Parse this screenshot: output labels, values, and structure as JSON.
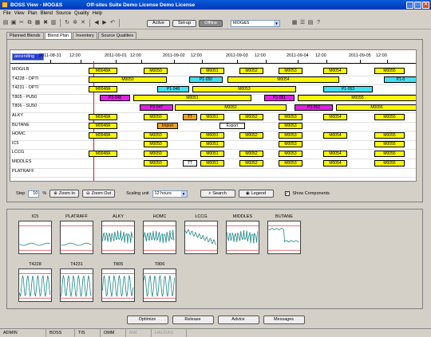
{
  "window": {
    "title": "BOSS View - MOG&S",
    "subtitle": "Off-sites Suite Demo License     Demo License"
  },
  "menu": [
    "File",
    "View",
    "Plan",
    "Blend",
    "Source",
    "Quality",
    "Help"
  ],
  "toolbar": {
    "modes": [
      "Active",
      "Set-up",
      "Offline"
    ],
    "selected_mode": "Offline",
    "site_combo": "MOG&S"
  },
  "tabs": [
    "Planned Blends",
    "Blend Plan",
    "Inventory",
    "Source Qualities"
  ],
  "selected_tab": "Blend Plan",
  "gantt": {
    "sort": "ascending",
    "dates": [
      "2011-08-31",
      "12:00",
      "2011-09-01",
      "12:00",
      "2011-09-02",
      "12:00",
      "2011-09-03",
      "12:00",
      "2011-09-04",
      "12:00",
      "2011-09-05",
      "12:00"
    ],
    "rows": [
      "MOGILB",
      "T4228 - OPTI",
      "T4231 - OPTI",
      "T805 - PU50",
      "T806 - SU50",
      "ALKY",
      "BUTANE",
      "HOMC",
      "IC5",
      "LCCG",
      "MIDDLES",
      "PLATRAFF"
    ],
    "bars": [
      {
        "row": 0,
        "label": "M0048A",
        "color": "#f8f800"
      },
      {
        "row": 0,
        "label": "M0050",
        "color": "#f8f800"
      },
      {
        "row": 0,
        "label": "M0051",
        "color": "#f8f800"
      },
      {
        "row": 0,
        "label": "M0052",
        "color": "#f8f800"
      },
      {
        "row": 0,
        "label": "M0053",
        "color": "#f8f800"
      },
      {
        "row": 0,
        "label": "M0054",
        "color": "#f8f800"
      },
      {
        "row": 0,
        "label": "M0055",
        "color": "#f8f800"
      },
      {
        "row": 1,
        "label": "M0050",
        "color": "#f8f800"
      },
      {
        "row": 1,
        "label": "P1-050",
        "color": "#40e0f0"
      },
      {
        "row": 1,
        "label": "M0054",
        "color": "#f8f800"
      },
      {
        "row": 1,
        "label": "P1-0",
        "color": "#40e0f0"
      },
      {
        "row": 2,
        "label": "M0048A",
        "color": "#f8f800"
      },
      {
        "row": 2,
        "label": "P1-048",
        "color": "#40e0f0"
      },
      {
        "row": 2,
        "label": "M0053",
        "color": "#f8f800"
      },
      {
        "row": 2,
        "label": "P1-053",
        "color": "#40e0f0"
      },
      {
        "row": 3,
        "label": "P3-048",
        "color": "#e020e0"
      },
      {
        "row": 3,
        "label": "M0051",
        "color": "#f8f800"
      },
      {
        "row": 3,
        "label": "P3-051",
        "color": "#e020e0"
      },
      {
        "row": 3,
        "label": "M0055",
        "color": "#f8f800"
      },
      {
        "row": 4,
        "label": "P3-047",
        "color": "#e020e0"
      },
      {
        "row": 4,
        "label": "M0052",
        "color": "#f8f800"
      },
      {
        "row": 4,
        "label": "P3-052",
        "color": "#e020e0"
      },
      {
        "row": 4,
        "label": "M0056",
        "color": "#f8f800"
      },
      {
        "row": 5,
        "label": "M0048A",
        "color": "#f8f800"
      },
      {
        "row": 5,
        "label": "M0050",
        "color": "#f8f800"
      },
      {
        "row": 5,
        "label": "TT",
        "color": "#f0a020"
      },
      {
        "row": 5,
        "label": "M0051",
        "color": "#f8f800"
      },
      {
        "row": 5,
        "label": "M0052",
        "color": "#f8f800"
      },
      {
        "row": 5,
        "label": "M0053",
        "color": "#f8f800"
      },
      {
        "row": 5,
        "label": "M0054",
        "color": "#f8f800"
      },
      {
        "row": 5,
        "label": "M0055",
        "color": "#f8f800"
      },
      {
        "row": 6,
        "label": "M0048A",
        "color": "#f8f800"
      },
      {
        "row": 6,
        "label": "Import",
        "color": "#f0a020"
      },
      {
        "row": 6,
        "label": "Export",
        "color": "#ffffff"
      },
      {
        "row": 6,
        "label": "M0053",
        "color": "#f8f800"
      },
      {
        "row": 7,
        "label": "M0048A",
        "color": "#f8f800"
      },
      {
        "row": 7,
        "label": "M0050",
        "color": "#f8f800"
      },
      {
        "row": 7,
        "label": "M0051",
        "color": "#f8f800"
      },
      {
        "row": 7,
        "label": "M0052",
        "color": "#f8f800"
      },
      {
        "row": 7,
        "label": "M0053",
        "color": "#f8f800"
      },
      {
        "row": 7,
        "label": "M0054",
        "color": "#f8f800"
      },
      {
        "row": 7,
        "label": "M0055",
        "color": "#f8f800"
      },
      {
        "row": 8,
        "label": "M0050",
        "color": "#f8f800"
      },
      {
        "row": 8,
        "label": "M0051",
        "color": "#f8f800"
      },
      {
        "row": 8,
        "label": "M0053",
        "color": "#f8f800"
      },
      {
        "row": 8,
        "label": "M0055",
        "color": "#f8f800"
      },
      {
        "row": 9,
        "label": "M0048A",
        "color": "#f8f800"
      },
      {
        "row": 9,
        "label": "M0050",
        "color": "#f8f800"
      },
      {
        "row": 9,
        "label": "M0051",
        "color": "#f8f800"
      },
      {
        "row": 9,
        "label": "M0052",
        "color": "#f8f800"
      },
      {
        "row": 9,
        "label": "M0053",
        "color": "#f8f800"
      },
      {
        "row": 9,
        "label": "M0054",
        "color": "#f8f800"
      },
      {
        "row": 9,
        "label": "M0055",
        "color": "#f8f800"
      },
      {
        "row": 10,
        "label": "M0050",
        "color": "#f8f800"
      },
      {
        "row": 10,
        "label": "TT",
        "color": "#ffffff"
      },
      {
        "row": 10,
        "label": "M0051",
        "color": "#f8f800"
      },
      {
        "row": 10,
        "label": "M0052",
        "color": "#f8f800"
      },
      {
        "row": 10,
        "label": "M0053",
        "color": "#f8f800"
      },
      {
        "row": 10,
        "label": "M0054",
        "color": "#f8f800"
      },
      {
        "row": 10,
        "label": "M0055",
        "color": "#f8f800"
      }
    ]
  },
  "controls": {
    "step_label": "Step",
    "step_value": "10",
    "step_unit": "%",
    "zoom_in": "Zoom In",
    "zoom_out": "Zoom Out",
    "scaling_label": "Scaling unit",
    "scaling_value": "12 hours",
    "search": "Search",
    "legend": "Legend",
    "show_components": "Show Components",
    "show_components_checked": true
  },
  "thumbnails": [
    "IC5",
    "PLATRAFF",
    "ALKY",
    "HOMC",
    "LCCG",
    "MIDDLES",
    "BUTANE",
    "T4228",
    "T4231",
    "T805",
    "T806"
  ],
  "actions": [
    "Optimize",
    "Release",
    "Advice",
    "Messages"
  ],
  "status": [
    "ADMIN",
    "BOSS",
    "TIS",
    "OMM",
    "MAI",
    "HAUDAS"
  ],
  "status_dim": [
    "MAI",
    "HAUDAS"
  ]
}
